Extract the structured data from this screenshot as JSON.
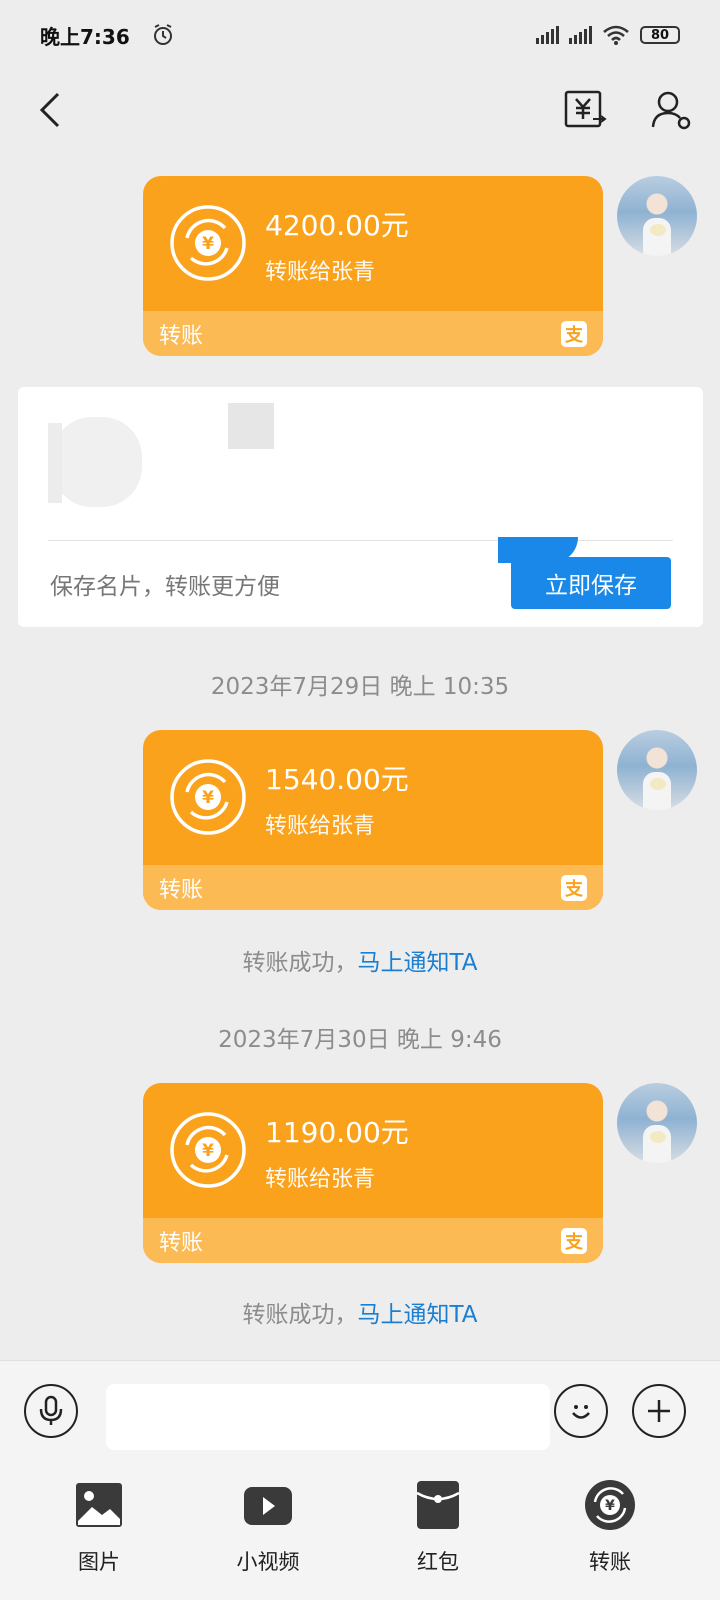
{
  "status_bar": {
    "time": "晚上7:36",
    "battery": "80"
  },
  "messages": [
    {
      "amount": "4200.00元",
      "to": "转账给张青",
      "label": "转账",
      "alipay": "支"
    },
    {
      "amount": "1540.00元",
      "to": "转账给张青",
      "label": "转账",
      "alipay": "支"
    },
    {
      "amount": "1190.00元",
      "to": "转账给张青",
      "label": "转账",
      "alipay": "支"
    }
  ],
  "save_card": {
    "text": "保存名片，转账更方便",
    "button": "立即保存"
  },
  "timestamps": [
    "2023年7月29日 晚上 10:35",
    "2023年7月30日 晚上 9:46"
  ],
  "transfer_status": {
    "text": "转账成功，",
    "link": "马上通知TA"
  },
  "toolbar": {
    "items": [
      {
        "label": "图片",
        "icon": "image-icon"
      },
      {
        "label": "小视频",
        "icon": "video-icon"
      },
      {
        "label": "红包",
        "icon": "red-envelope-icon"
      },
      {
        "label": "转账",
        "icon": "transfer-icon"
      }
    ]
  },
  "colors": {
    "card_orange": "#fba21c",
    "card_footer": "#fcba55",
    "link_blue": "#1a7fd1",
    "button_blue": "#1988e8"
  }
}
